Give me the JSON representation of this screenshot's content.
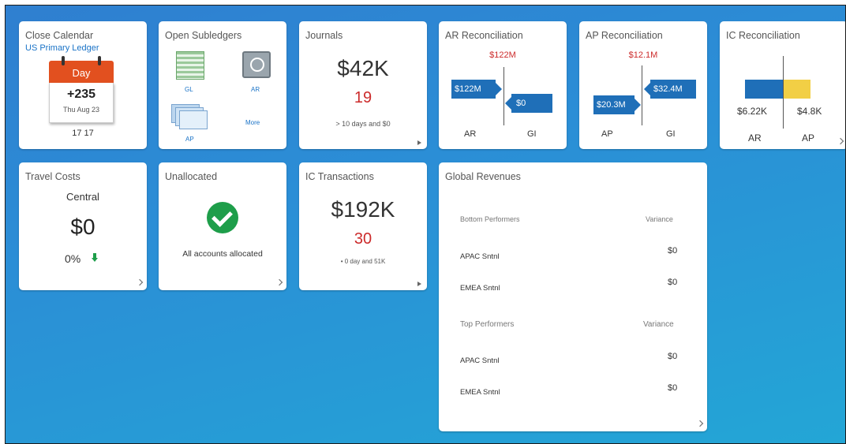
{
  "close_calendar": {
    "title": "Close Calendar",
    "ledger": "US Primary Ledger",
    "day_label": "Day",
    "day_value": "+235",
    "date": "Thu Aug 23",
    "count": "17 17"
  },
  "open_subledgers": {
    "title": "Open Subledgers",
    "items": [
      "GL",
      "AR",
      "AP",
      "More"
    ]
  },
  "journals": {
    "title": "Journals",
    "amount": "$42K",
    "count": "19",
    "note": "> 10 days and $0"
  },
  "ar_recon": {
    "title": "AR Reconciliation",
    "total": "$122M",
    "left_value": "$122M",
    "right_value": "$0",
    "left_label": "AR",
    "right_label": "GI"
  },
  "ap_recon": {
    "title": "AP Reconciliation",
    "total": "$12.1M",
    "left_value": "$20.3M",
    "right_value": "$32.4M",
    "left_label": "AP",
    "right_label": "GI"
  },
  "ic_recon": {
    "title": "IC Reconciliation",
    "left_value": "$6.22K",
    "right_value": "$4.8K",
    "left_label": "AR",
    "right_label": "AP",
    "colors": {
      "left": "#1f6fb8",
      "right": "#f2cf45"
    }
  },
  "travel_costs": {
    "title": "Travel Costs",
    "region": "Central",
    "amount": "$0",
    "percent": "0%"
  },
  "unallocated": {
    "title": "Unallocated",
    "message": "All accounts allocated"
  },
  "ic_transactions": {
    "title": "IC Transactions",
    "amount": "$192K",
    "count": "30",
    "note": "• 0 day and 51K"
  },
  "global_revenues": {
    "title": "Global Revenues",
    "bottom_header": "Bottom Performers",
    "top_header": "Top Performers",
    "variance_label": "Variance",
    "bottom_rows": [
      {
        "name": "APAC Sntnl",
        "value": "$0"
      },
      {
        "name": "EMEA Sntnl",
        "value": "$0"
      }
    ],
    "top_rows": [
      {
        "name": "APAC Sntnl",
        "value": "$0"
      },
      {
        "name": "EMEA Sntnl",
        "value": "$0"
      }
    ]
  },
  "colors": {
    "accent_blue": "#1a73c7",
    "alert_red": "#cc2b2b",
    "calendar_orange": "#e2501f",
    "success_green": "#1e9e4a"
  }
}
